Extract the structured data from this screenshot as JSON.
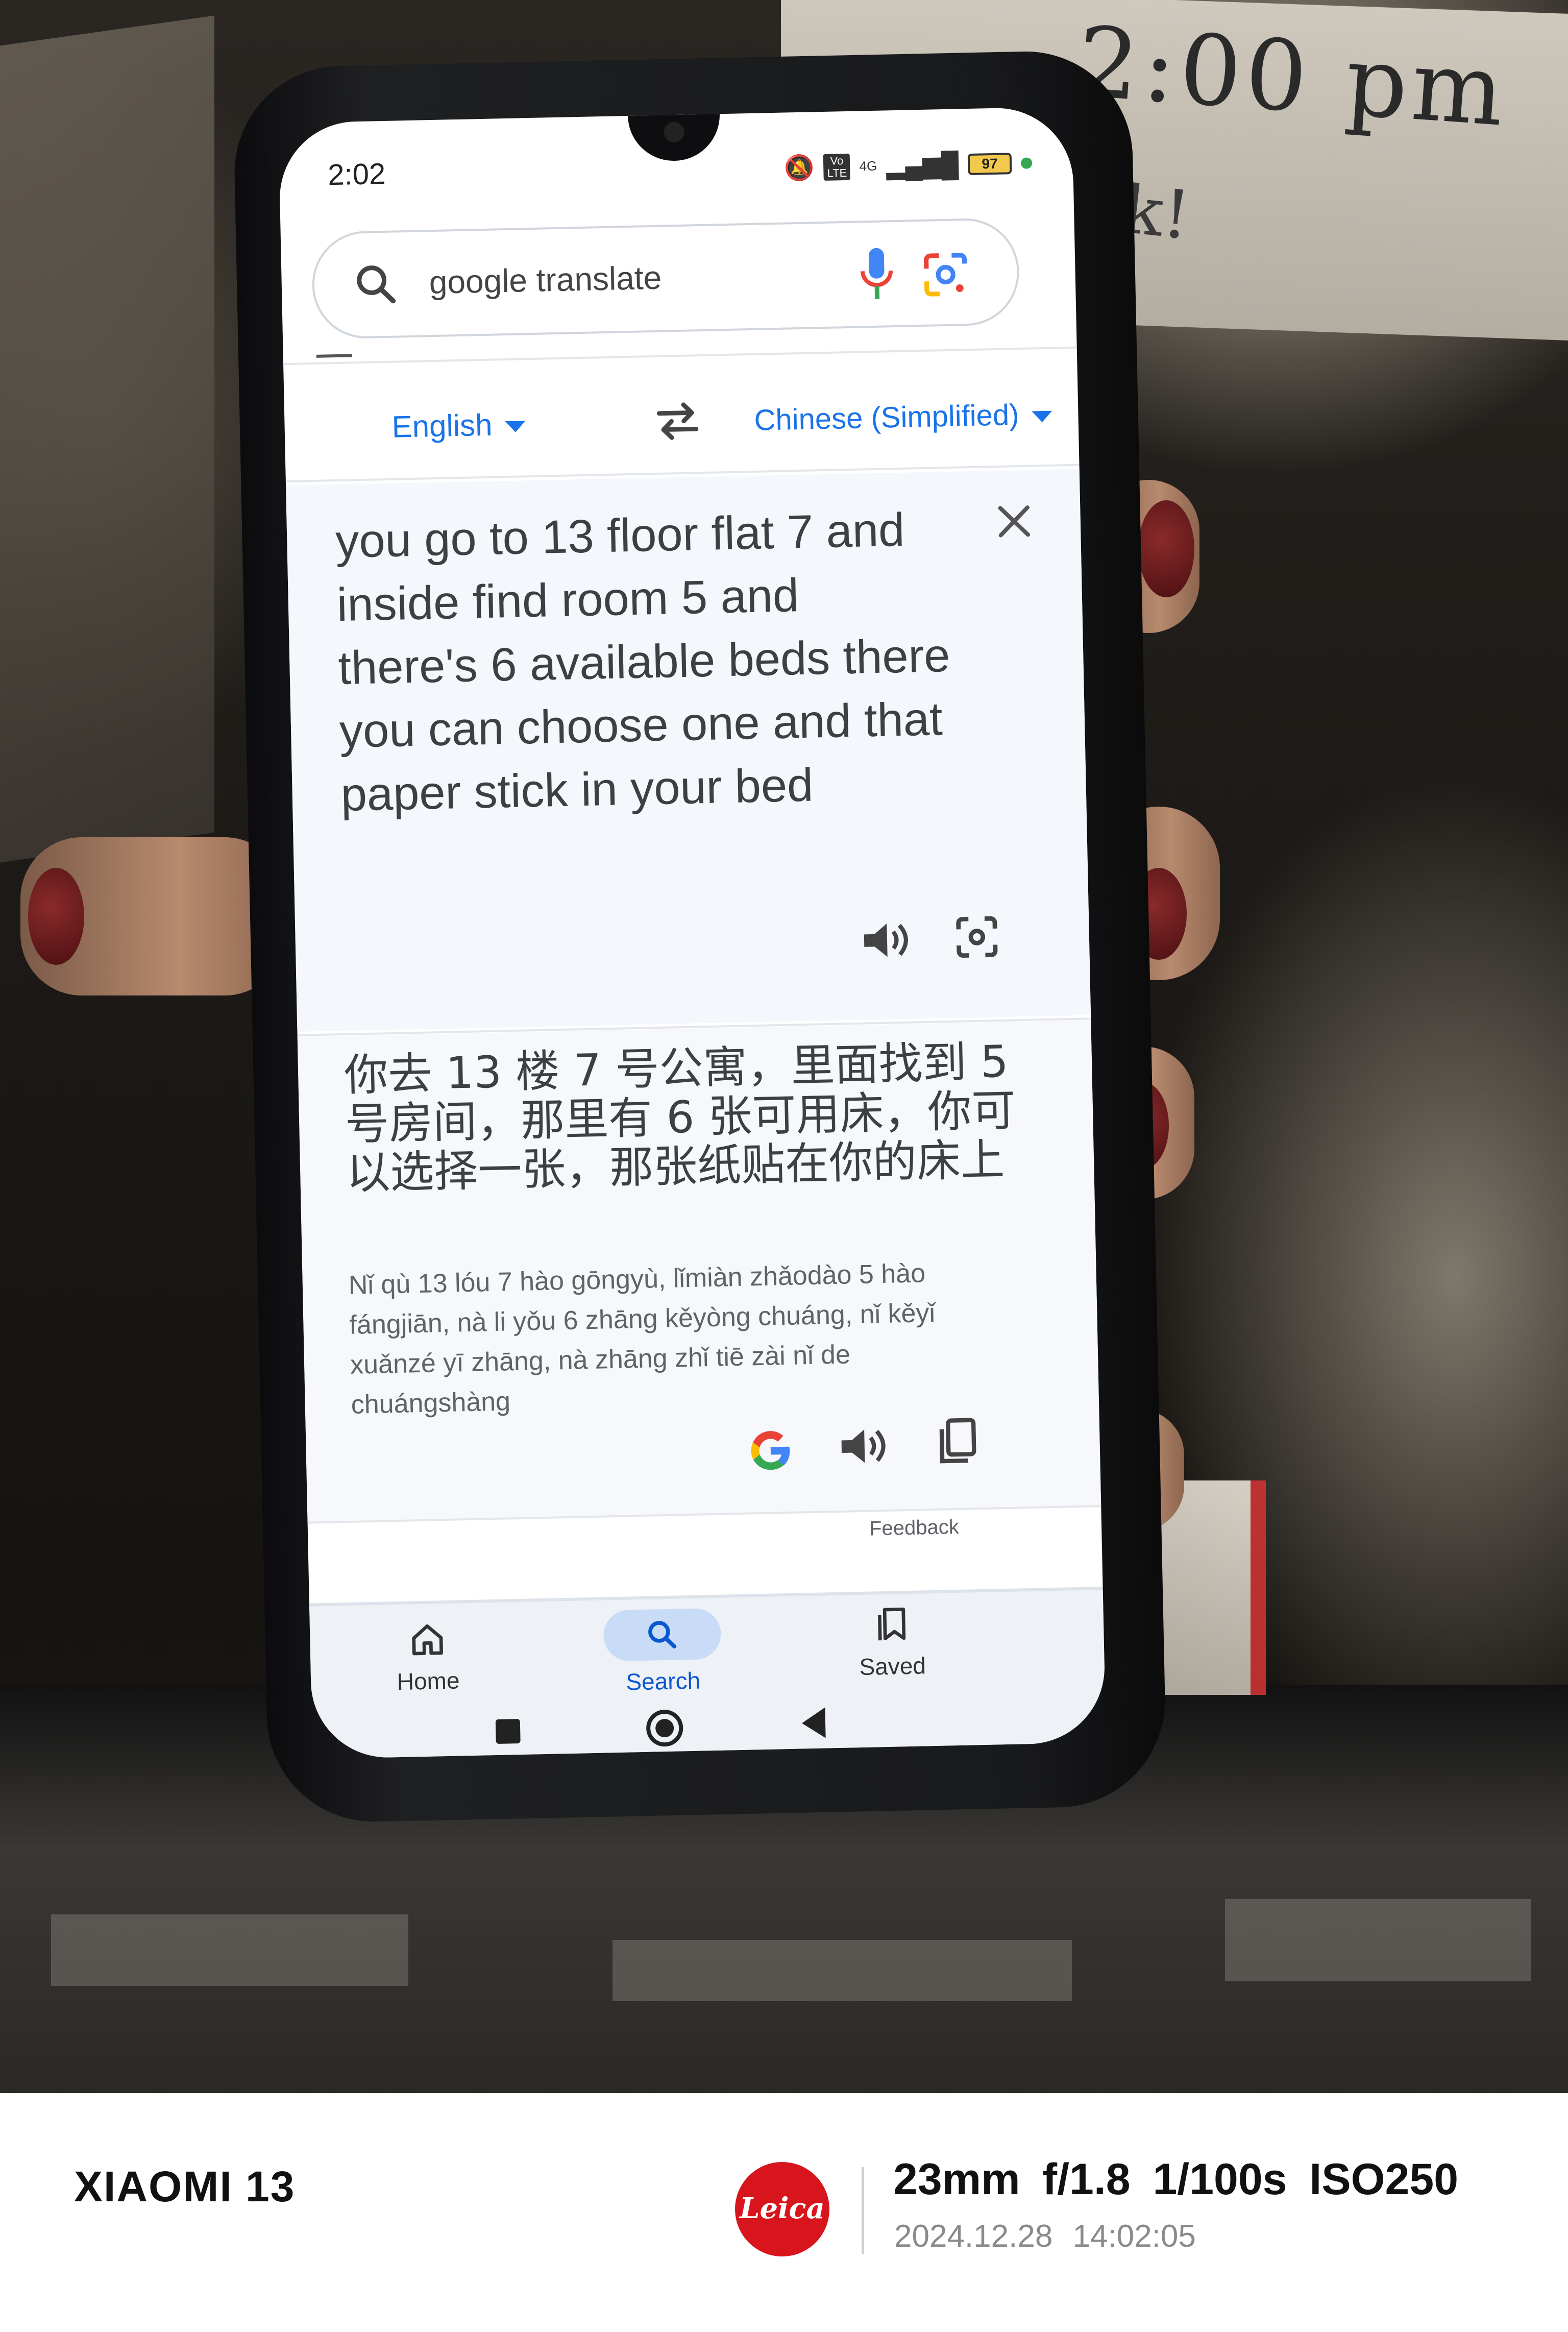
{
  "photo": {
    "background_writing": {
      "time": "2:00 pm",
      "fragment": "k!"
    }
  },
  "phone": {
    "status_bar": {
      "time": "2:02",
      "network": "4G",
      "vo_lte": "Vo LTE",
      "battery": "97"
    },
    "search": {
      "query": "google translate"
    },
    "translator": {
      "source_language": "English",
      "target_language": "Chinese (Simplified)",
      "source_text": "you go to 13 floor flat 7 and inside find room 5 and there's 6 available beds there you can choose one and that paper stick in your bed",
      "translated_text": "你去 13 楼 7 号公寓，里面找到 5 号房间，那里有 6 张可用床，你可以选择一张，那张纸贴在你的床上",
      "pinyin": "Nǐ qù 13 lóu 7 hào gōngyù, lǐmiàn zhǎodào 5 hào fángjiān, nà li yǒu 6 zhāng kěyòng chuáng, nǐ kěyǐ xuǎnzé yī zhāng, nà zhāng zhǐ tiē zài nǐ de chuángshàng",
      "feedback_label": "Feedback"
    },
    "bottom_nav": {
      "home": "Home",
      "search": "Search",
      "saved": "Saved"
    }
  },
  "watermark": {
    "device": "XIAOMI 13",
    "brand": "Leica",
    "exif": "23mm  f/1.8  1/100s  ISO250",
    "datetime": "2024.12.28  14:02:05",
    "logo_color": "#d8151c"
  },
  "colors": {
    "google_blue": "#1a73e8",
    "google_red": "#ea4335",
    "google_yellow": "#fbbc05",
    "google_green": "#34a853"
  }
}
